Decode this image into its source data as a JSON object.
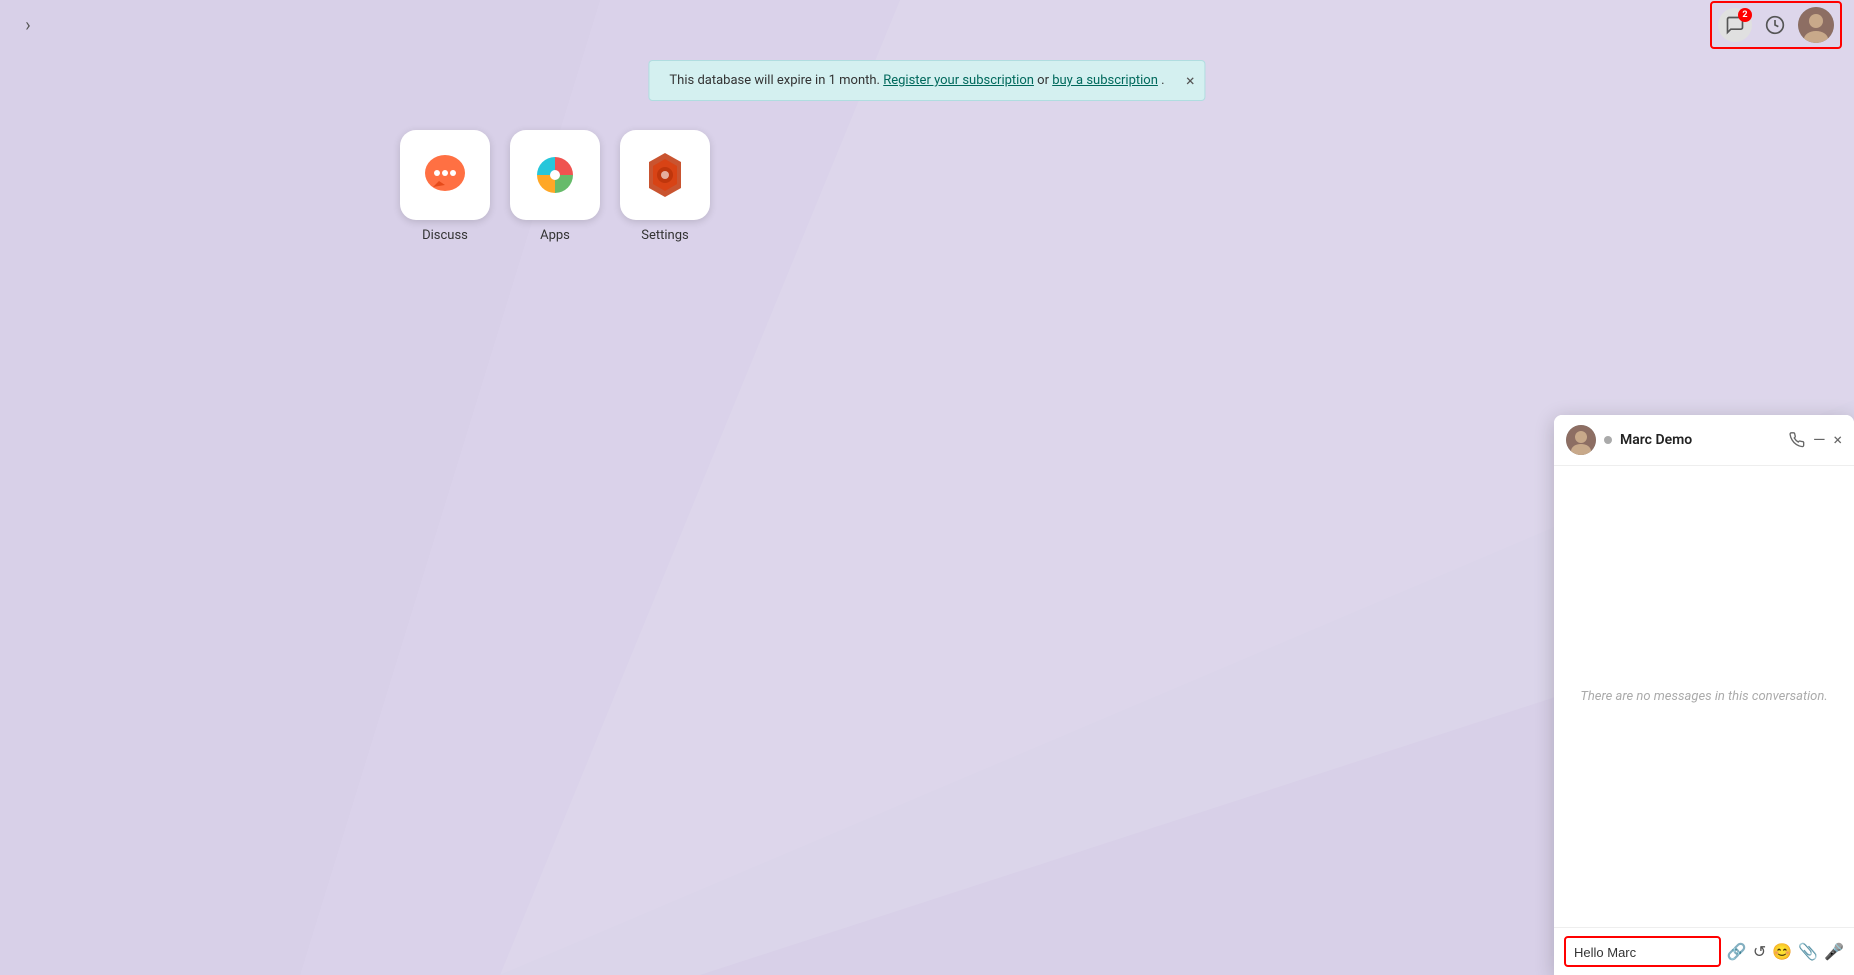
{
  "background": {
    "color": "#d8d0e8"
  },
  "topbar": {
    "sidebar_toggle_label": "›",
    "notification_badge": "2",
    "icons": {
      "messages": "messages-icon",
      "settings": "gear-icon",
      "avatar": "user-avatar"
    }
  },
  "banner": {
    "text_before": "This database will expire in 1 month.",
    "link1_text": "Register your subscription",
    "text_between": " or ",
    "link2_text": "buy a subscription",
    "text_after": ".",
    "close_label": "×"
  },
  "apps": [
    {
      "id": "discuss",
      "label": "Discuss",
      "icon_type": "discuss"
    },
    {
      "id": "apps",
      "label": "Apps",
      "icon_type": "apps"
    },
    {
      "id": "settings",
      "label": "Settings",
      "icon_type": "settings"
    }
  ],
  "chat": {
    "contact_name": "Marc Demo",
    "status": "offline",
    "no_messages_text": "There are no messages in this conversation.",
    "input_value": "Hello Marc",
    "controls": {
      "call": "📞",
      "minimize": "—",
      "close": "×"
    }
  }
}
